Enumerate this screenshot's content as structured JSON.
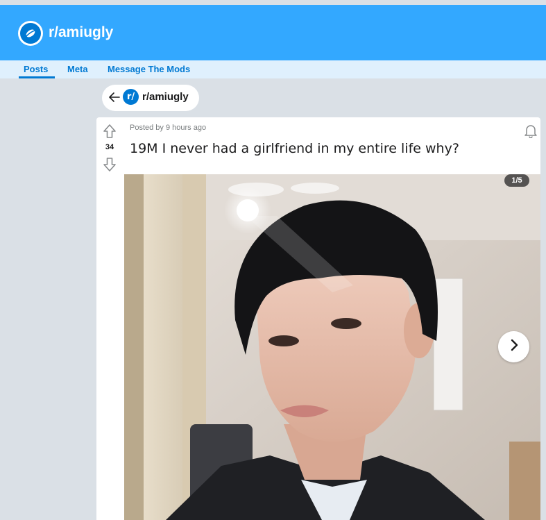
{
  "subreddit": {
    "name": "r/amiugly",
    "banner_color": "#33a8ff",
    "icon": "planet-icon",
    "avatar_glyph": "r/"
  },
  "nav": {
    "items": [
      {
        "label": "Posts",
        "active": true
      },
      {
        "label": "Meta",
        "active": false
      },
      {
        "label": "Message The Mods",
        "active": false
      }
    ]
  },
  "back_pill": {
    "icon": "back-arrow-icon",
    "label": "r/amiugly"
  },
  "post": {
    "vote_count": "34",
    "meta": "Posted by 9 hours ago",
    "title": "19M I never had a girlfriend in my entire life why?",
    "gallery_counter": "1/5",
    "image_alt": "selfie photo of a young man in a suit jacket under a ceiling fan"
  }
}
